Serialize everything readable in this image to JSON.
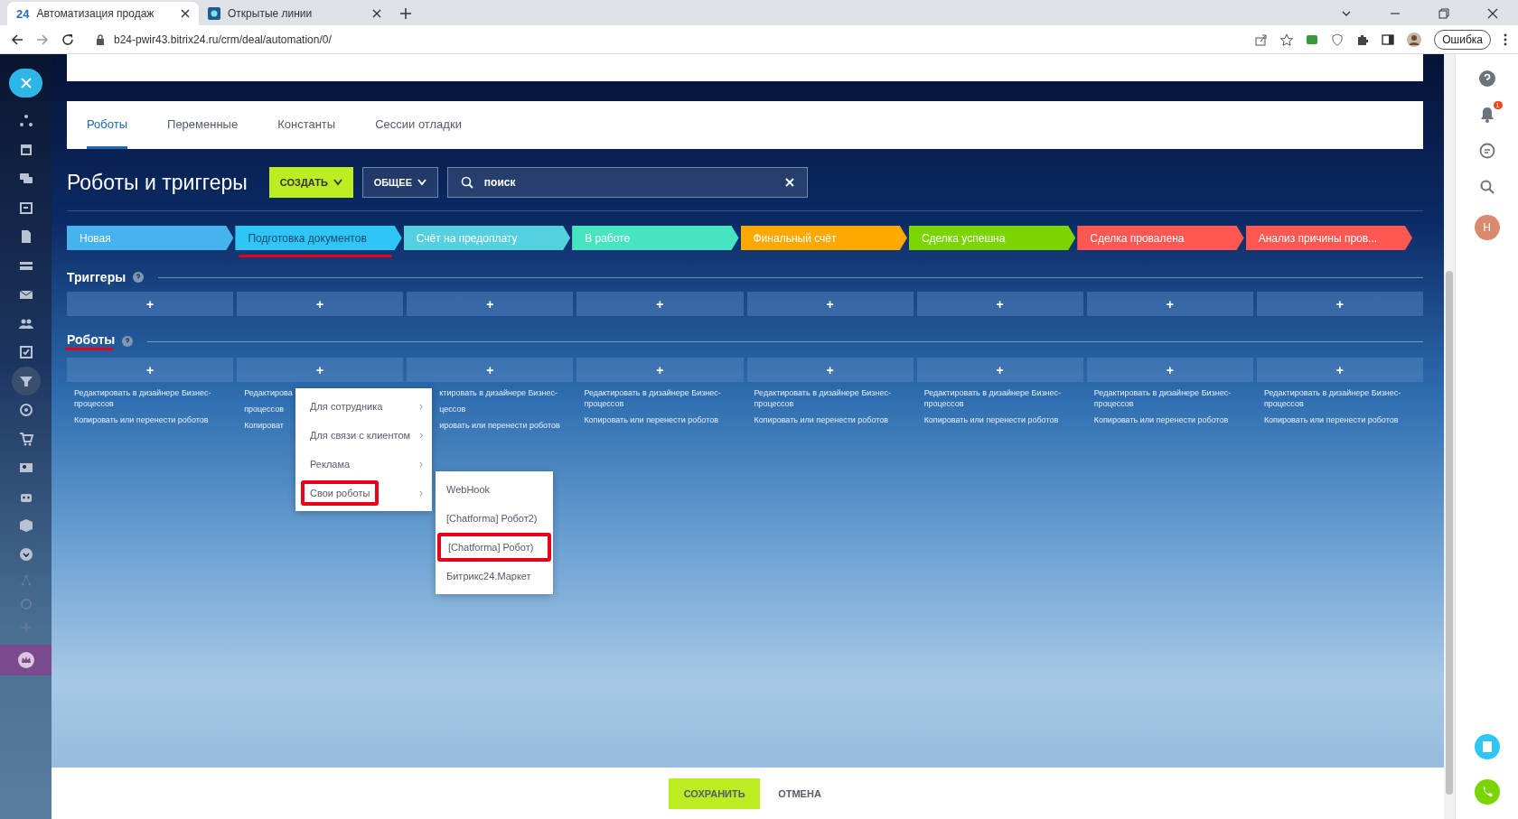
{
  "browser": {
    "tabs": [
      {
        "title": "Автоматизация продаж",
        "selected": true,
        "logo": "24"
      },
      {
        "title": "Открытые линии",
        "selected": false
      }
    ],
    "address": "b24-pwir43.bitrix24.ru/crm/deal/automation/0/",
    "profile_button": "Ошибка"
  },
  "tabs": [
    {
      "label": "Роботы",
      "selected": true
    },
    {
      "label": "Переменные",
      "selected": false
    },
    {
      "label": "Константы",
      "selected": false
    },
    {
      "label": "Сессии отладки",
      "selected": false
    }
  ],
  "title": "Роботы и триггеры",
  "create_button": "СОЗДАТЬ",
  "filter_button": "ОБЩЕЕ",
  "search": {
    "value": "поиск"
  },
  "stages": [
    {
      "name": "Новая",
      "color": "#47b3ee",
      "selected": false
    },
    {
      "name": "Подготовка документов",
      "color": "#2fc6f6",
      "selected": true
    },
    {
      "name": "Счёт на предоплату",
      "color": "#55d0e0",
      "selected": false
    },
    {
      "name": "В работе",
      "color": "#47e4c2",
      "selected": false
    },
    {
      "name": "Финальный счёт",
      "color": "#ffa900",
      "selected": false
    },
    {
      "name": "Сделка успешна",
      "color": "#7bd500",
      "selected": false
    },
    {
      "name": "Сделка провалена",
      "color": "#ff5752",
      "selected": false
    },
    {
      "name": "Анализ причины пров...",
      "color": "#ff5752",
      "selected": false
    }
  ],
  "triggers": {
    "title": "Триггеры",
    "add_buttons": [
      "+",
      "+",
      "+",
      "+",
      "+",
      "+",
      "+",
      "+"
    ]
  },
  "robots": {
    "title": "Роботы",
    "underlined": true,
    "add_buttons": [
      "+",
      "+",
      "+",
      "+",
      "+",
      "+",
      "+",
      "+"
    ],
    "columns": [
      {
        "links": [
          "Редактировать в дизайнере Бизнес-процессов",
          "Копировать или перенести роботов"
        ],
        "cut_start": false
      },
      {
        "links": [
          "Редактирова",
          "процессов",
          "Копироват"
        ],
        "cut_start": false
      },
      {
        "links": [
          "ктировать в дизайнере Бизнес-",
          "цессов",
          "ировать или перенести роботов"
        ],
        "cut_start": true
      },
      {
        "links": [
          "Редактировать в дизайнере Бизнес-процессов",
          "Копировать или перенести роботов"
        ],
        "cut_start": false
      },
      {
        "links": [
          "Редактировать в дизайнере Бизнес-процессов",
          "Копировать или перенести роботов"
        ],
        "cut_start": false
      },
      {
        "links": [
          "Редактировать в дизайнере Бизнес-процессов",
          "Копировать или перенести роботов"
        ],
        "cut_start": false
      },
      {
        "links": [
          "Редактировать в дизайнере Бизнес-процессов",
          "Копировать или перенести роботов"
        ],
        "cut_start": false
      },
      {
        "links": [
          "Редактировать в дизайнере Бизнес-процессов",
          "Копировать или перенести роботов"
        ],
        "cut_start": false
      }
    ]
  },
  "menu": [
    {
      "label": "Для сотрудника",
      "arrow": "›",
      "highlighted": false
    },
    {
      "label": "Для связи с клиентом",
      "arrow": "›",
      "highlighted": false
    },
    {
      "label": "Реклама",
      "arrow": "›",
      "highlighted": false
    },
    {
      "label": "Свои роботы",
      "arrow": "›",
      "highlighted": true
    }
  ],
  "submenu": [
    {
      "label": "WebHook",
      "highlighted": false
    },
    {
      "label": "[Chatforma] Робот2)",
      "highlighted": false
    },
    {
      "label": "[Chatforma] Робот)",
      "highlighted": true
    },
    {
      "label": "Битрикс24.Маркет",
      "highlighted": false
    }
  ],
  "right_panel": {
    "notification_count": "1",
    "avatar": "Н"
  },
  "footer": {
    "save": "СОХРАНИТЬ",
    "cancel": "ОТМЕНА"
  }
}
